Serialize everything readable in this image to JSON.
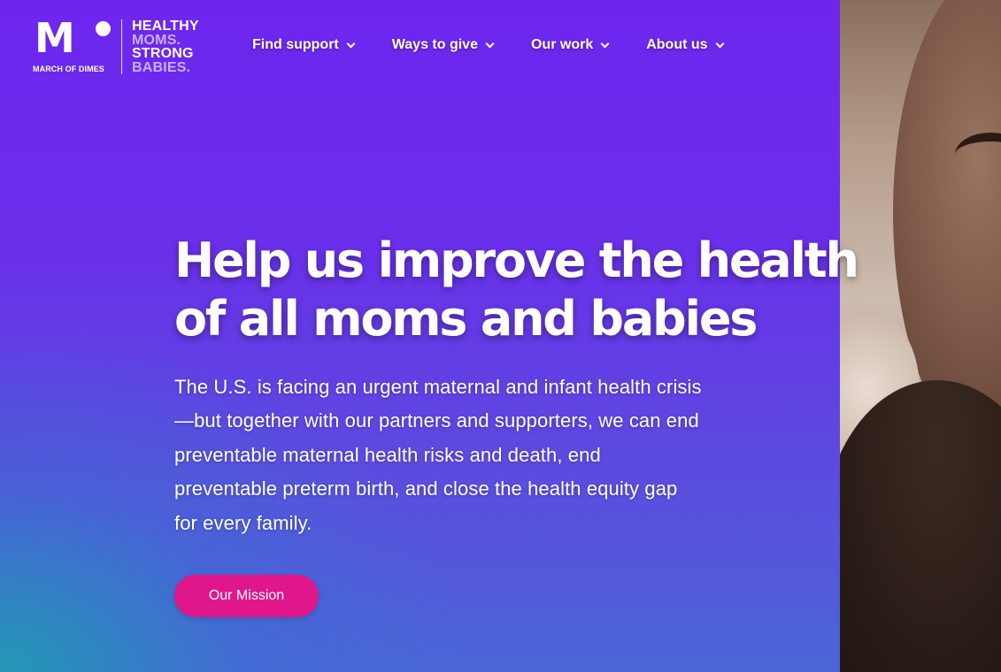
{
  "brand": {
    "logo_mark": "M",
    "logo_subtext": "MARCH OF DIMES",
    "tagline": [
      "HEALTHY",
      "MOMS.",
      "STRONG",
      "BABIES."
    ]
  },
  "nav": {
    "items": [
      {
        "label": "Find support"
      },
      {
        "label": "Ways to give"
      },
      {
        "label": "Our work"
      },
      {
        "label": "About us"
      }
    ]
  },
  "hero": {
    "headline_line1": "Help us improve the health",
    "headline_line2": "of all moms and babies",
    "body": "The U.S. is facing an urgent maternal and infant health crisis—but together with our partners and supporters, we can end preventable maternal health risks and death, end preventable preterm birth, and close the health equity gap for every family.",
    "cta_label": "Our Mission"
  },
  "colors": {
    "hero_purple": "#6f27ec",
    "hero_teal": "#219bb4",
    "cta_pink": "#e0178a",
    "tagline_lavender": "#c4b3ff"
  }
}
